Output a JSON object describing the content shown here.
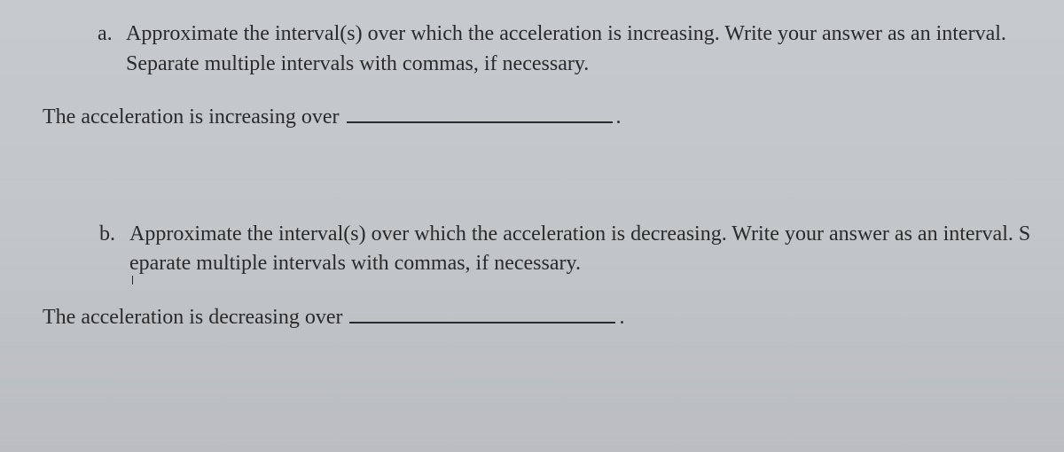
{
  "question_a": {
    "label": "a.",
    "text": "Approximate the interval(s) over which the acceleration is increasing. Write your answer as an interval. Separate multiple intervals with commas, if necessary.",
    "answer_prompt": "The acceleration is increasing over",
    "period": "."
  },
  "question_b": {
    "label": "b.",
    "text_part1": "Approximate the interval(s) over which the acceleration is decreasing. Write your answer as an interval. S",
    "text_cursor_char": "e",
    "text_part2": "parate multiple intervals with commas, if necessary.",
    "answer_prompt": "The acceleration is decreasing over",
    "period": "."
  }
}
